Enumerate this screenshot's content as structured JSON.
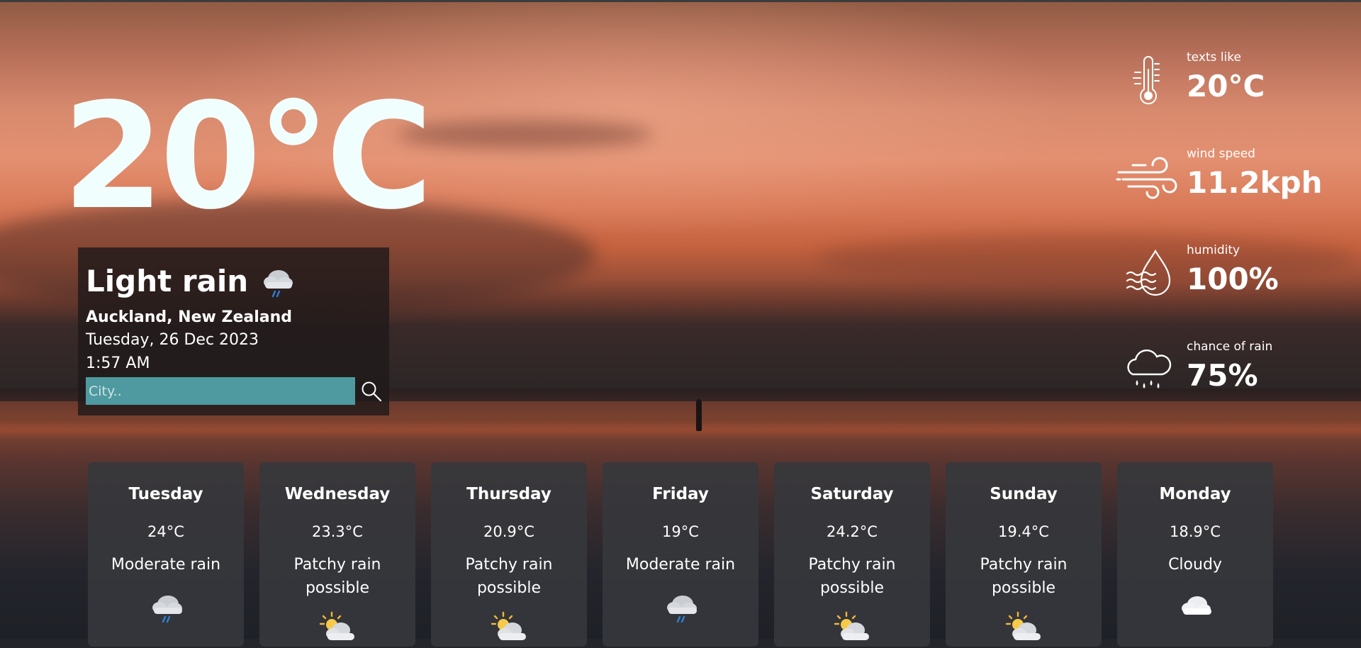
{
  "current": {
    "temperature": "20°C",
    "condition": "Light rain",
    "condition_icon": "light-rain-cloud-icon",
    "location": "Auckland,  New Zealand",
    "date": "Tuesday, 26 Dec 2023",
    "time": "1:57 AM"
  },
  "search": {
    "placeholder": "City..",
    "value": "",
    "button_icon": "search-icon"
  },
  "stats": [
    {
      "label": "texts like",
      "value": "20°C",
      "icon": "thermometer-icon"
    },
    {
      "label": "wind speed",
      "value": "11.2kph",
      "icon": "wind-icon"
    },
    {
      "label": "humidity",
      "value": "100%",
      "icon": "humidity-icon"
    },
    {
      "label": "chance of rain",
      "value": "75%",
      "icon": "rain-cloud-icon"
    }
  ],
  "forecast": [
    {
      "day": "Tuesday",
      "temp": "24°C",
      "condition": "Moderate rain",
      "icon": "rain-cloud-icon"
    },
    {
      "day": "Wednesday",
      "temp": "23.3°C",
      "condition": "Patchy rain possible",
      "icon": "sun-cloud-icon"
    },
    {
      "day": "Thursday",
      "temp": "20.9°C",
      "condition": "Patchy rain possible",
      "icon": "sun-cloud-icon"
    },
    {
      "day": "Friday",
      "temp": "19°C",
      "condition": "Moderate rain",
      "icon": "rain-cloud-icon"
    },
    {
      "day": "Saturday",
      "temp": "24.2°C",
      "condition": "Patchy rain possible",
      "icon": "sun-cloud-icon"
    },
    {
      "day": "Sunday",
      "temp": "19.4°C",
      "condition": "Patchy rain possible",
      "icon": "sun-cloud-icon"
    },
    {
      "day": "Monday",
      "temp": "18.9°C",
      "condition": "Cloudy",
      "icon": "cloud-icon"
    }
  ],
  "colors": {
    "search_field": "#4e9aa0",
    "card_background": "#36373c",
    "temperature_text": "#f0fffe"
  }
}
